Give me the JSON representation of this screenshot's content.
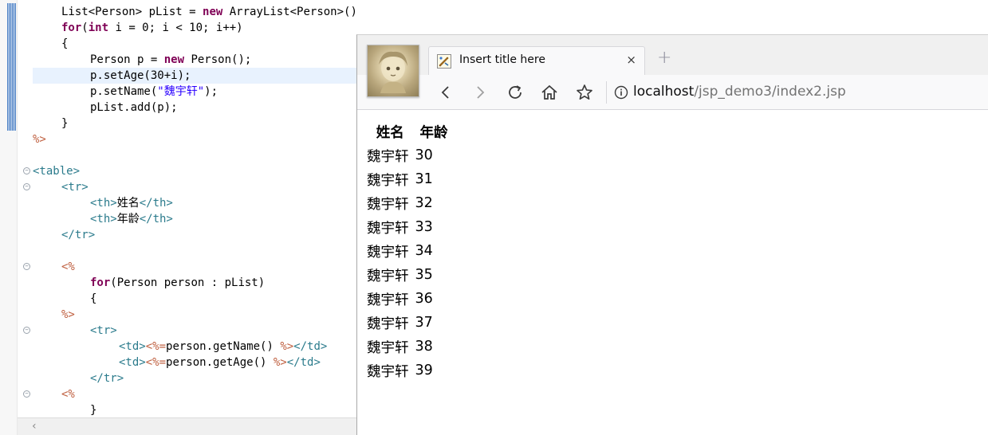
{
  "editor": {
    "lines": [
      {
        "indent": 1,
        "tokens": [
          [
            "t",
            "List<Person> pList = "
          ],
          [
            "kw",
            "new"
          ],
          [
            "t",
            " ArrayList<Person>();"
          ]
        ]
      },
      {
        "indent": 1,
        "tokens": [
          [
            "kw",
            "for"
          ],
          [
            "t",
            "("
          ],
          [
            "kw",
            "int"
          ],
          [
            "t",
            " i = 0; i < 10; i++)"
          ]
        ]
      },
      {
        "indent": 1,
        "tokens": [
          [
            "t",
            "{"
          ]
        ]
      },
      {
        "indent": 2,
        "tokens": [
          [
            "t",
            "Person p = "
          ],
          [
            "kw",
            "new"
          ],
          [
            "t",
            " Person();"
          ]
        ]
      },
      {
        "indent": 2,
        "current": true,
        "tokens": [
          [
            "t",
            "p.setAge(30+i);"
          ]
        ]
      },
      {
        "indent": 2,
        "tokens": [
          [
            "t",
            "p.setName("
          ],
          [
            "str",
            "\"魏宇轩\""
          ],
          [
            "t",
            ");"
          ]
        ]
      },
      {
        "indent": 2,
        "tokens": [
          [
            "t",
            "pList.add(p);"
          ]
        ]
      },
      {
        "indent": 1,
        "tokens": [
          [
            "t",
            "}"
          ]
        ]
      },
      {
        "indent": 0,
        "tokens": [
          [
            "delim",
            "%>"
          ]
        ]
      },
      {
        "indent": 0,
        "tokens": []
      },
      {
        "indent": 0,
        "fold": true,
        "tokens": [
          [
            "tag",
            "<table>"
          ]
        ]
      },
      {
        "indent": 1,
        "fold": true,
        "tokens": [
          [
            "tag",
            "<tr>"
          ]
        ]
      },
      {
        "indent": 2,
        "tokens": [
          [
            "tag",
            "<th>"
          ],
          [
            "t",
            "姓名"
          ],
          [
            "tag",
            "</th>"
          ]
        ]
      },
      {
        "indent": 2,
        "tokens": [
          [
            "tag",
            "<th>"
          ],
          [
            "t",
            "年龄"
          ],
          [
            "tag",
            "</th>"
          ]
        ]
      },
      {
        "indent": 1,
        "tokens": [
          [
            "tag",
            "</tr>"
          ]
        ]
      },
      {
        "indent": 0,
        "tokens": []
      },
      {
        "indent": 1,
        "fold": true,
        "tokens": [
          [
            "delim",
            "<%"
          ]
        ]
      },
      {
        "indent": 2,
        "tokens": [
          [
            "kw",
            "for"
          ],
          [
            "t",
            "(Person person : pList)"
          ]
        ]
      },
      {
        "indent": 2,
        "tokens": [
          [
            "t",
            "{"
          ]
        ]
      },
      {
        "indent": 1,
        "tokens": [
          [
            "delim",
            "%>"
          ]
        ]
      },
      {
        "indent": 2,
        "fold": true,
        "tokens": [
          [
            "tag",
            "<tr>"
          ]
        ]
      },
      {
        "indent": 3,
        "tokens": [
          [
            "tag",
            "<td>"
          ],
          [
            "delim",
            "<%="
          ],
          [
            "t",
            "person.getName() "
          ],
          [
            "delim",
            "%>"
          ],
          [
            "tag",
            "</td>"
          ]
        ]
      },
      {
        "indent": 3,
        "tokens": [
          [
            "tag",
            "<td>"
          ],
          [
            "delim",
            "<%="
          ],
          [
            "t",
            "person.getAge() "
          ],
          [
            "delim",
            "%>"
          ],
          [
            "tag",
            "</td>"
          ]
        ]
      },
      {
        "indent": 2,
        "tokens": [
          [
            "tag",
            "</tr>"
          ]
        ]
      },
      {
        "indent": 1,
        "fold": true,
        "tokens": [
          [
            "delim",
            "<%"
          ]
        ]
      },
      {
        "indent": 2,
        "tokens": [
          [
            "t",
            "}"
          ]
        ]
      }
    ]
  },
  "browser": {
    "tab_title": "Insert title here",
    "tab_close": "×",
    "new_tab": "+",
    "url_host": "localhost",
    "url_path": "/jsp_demo3/index2.jsp",
    "icons": {
      "back": "back-arrow-icon",
      "forward": "forward-arrow-icon",
      "reload": "reload-icon",
      "home": "home-icon",
      "bookmark": "star-icon",
      "info": "info-icon"
    },
    "table": {
      "headers": [
        "姓名",
        "年龄"
      ],
      "rows": [
        [
          "魏宇轩",
          "30"
        ],
        [
          "魏宇轩",
          "31"
        ],
        [
          "魏宇轩",
          "32"
        ],
        [
          "魏宇轩",
          "33"
        ],
        [
          "魏宇轩",
          "34"
        ],
        [
          "魏宇轩",
          "35"
        ],
        [
          "魏宇轩",
          "36"
        ],
        [
          "魏宇轩",
          "37"
        ],
        [
          "魏宇轩",
          "38"
        ],
        [
          "魏宇轩",
          "39"
        ]
      ]
    }
  },
  "colors": {
    "keyword": "#7f0055",
    "tag": "#2b7b8c",
    "jsp_delimiter": "#bf5f3f",
    "string": "#2a00ff",
    "current_line": "#e8f2fe"
  }
}
